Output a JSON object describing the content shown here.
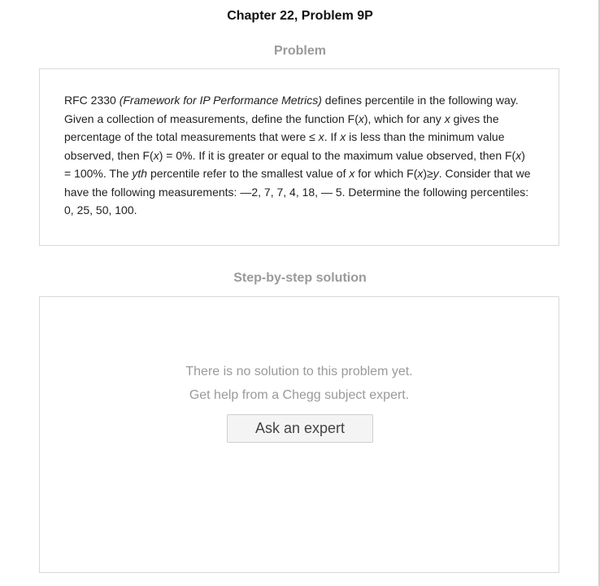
{
  "header": {
    "chapter_title": "Chapter 22, Problem 9P"
  },
  "problem": {
    "heading": "Problem",
    "text_segments": [
      {
        "t": "RFC 2330 ",
        "i": false
      },
      {
        "t": "(Framework for IP Performance Metrics)",
        "i": true
      },
      {
        "t": " defines percentile in the following way. Given a collection of measurements, define the function F(",
        "i": false
      },
      {
        "t": "x",
        "i": true
      },
      {
        "t": "), which for any ",
        "i": false
      },
      {
        "t": "x",
        "i": true
      },
      {
        "t": " gives the percentage of the total measurements that were ≤ ",
        "i": false
      },
      {
        "t": "x",
        "i": true
      },
      {
        "t": ". If ",
        "i": false
      },
      {
        "t": "x",
        "i": true
      },
      {
        "t": " is less than the minimum value observed, then F(",
        "i": false
      },
      {
        "t": "x",
        "i": true
      },
      {
        "t": ") = 0%. If it is greater or equal to the maximum value observed, then F(",
        "i": false
      },
      {
        "t": "x",
        "i": true
      },
      {
        "t": ") = 100%. The ",
        "i": false
      },
      {
        "t": "yth",
        "i": true
      },
      {
        "t": " percentile refer to the smallest value of ",
        "i": false
      },
      {
        "t": "x",
        "i": true
      },
      {
        "t": " for which F(",
        "i": false
      },
      {
        "t": "x",
        "i": true
      },
      {
        "t": ")≥",
        "i": false
      },
      {
        "t": "y",
        "i": true
      },
      {
        "t": ". Consider that we have the following measurements: —2, 7, 7, 4, 18, — 5. Determine the following percentiles: 0, 25, 50, 100.",
        "i": false
      }
    ]
  },
  "solution": {
    "heading": "Step-by-step solution",
    "no_solution_line1": "There is no solution to this problem yet.",
    "no_solution_line2": "Get help from a Chegg subject expert.",
    "ask_button_label": "Ask an expert"
  }
}
